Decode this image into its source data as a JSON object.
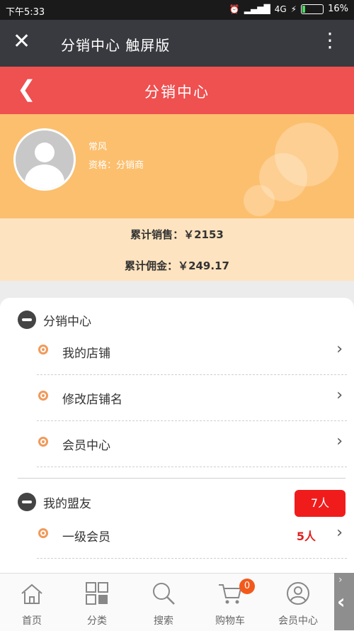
{
  "status_bar": {
    "time": "下午5:33",
    "network": "4G",
    "battery_text": "16%",
    "battery_level": 0.16
  },
  "app_bar": {
    "close_icon": "close-icon",
    "title": "分销中心 触屏版",
    "more_icon": "more-vertical-icon"
  },
  "page_header": {
    "back_icon": "chevron-left-icon",
    "title": "分销中心"
  },
  "profile": {
    "name": "常风",
    "level": "资格：分销商"
  },
  "stats": {
    "sales_label": "累计销售：",
    "sales_value": "￥2153",
    "commission_label": "累计佣金：",
    "commission_value": "￥249.17"
  },
  "sections": [
    {
      "title": "分销中心",
      "items": [
        {
          "label": "我的店铺"
        },
        {
          "label": "修改店铺名"
        },
        {
          "label": "会员中心"
        }
      ]
    },
    {
      "title": "我的盟友",
      "badge": "7人",
      "items": [
        {
          "label": "一级会员",
          "count": "5人"
        }
      ]
    }
  ],
  "tabbar": {
    "items": [
      {
        "label": "首页",
        "icon": "home-icon"
      },
      {
        "label": "分类",
        "icon": "grid-icon"
      },
      {
        "label": "搜索",
        "icon": "search-icon"
      },
      {
        "label": "购物车",
        "icon": "cart-icon",
        "badge": "0"
      },
      {
        "label": "会员中心",
        "icon": "user-icon"
      }
    ]
  },
  "colors": {
    "header_red": "#ef5050",
    "profile_orange": "#fcbf6e",
    "stats_bg": "#fde3bf",
    "accent_dot": "#f19a5a",
    "badge_red": "#f01c1c"
  }
}
